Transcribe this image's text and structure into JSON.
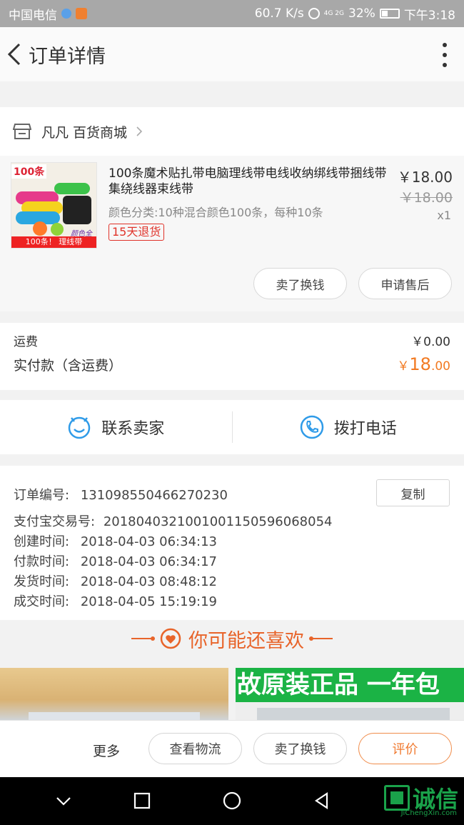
{
  "statusbar": {
    "carrier": "中国电信",
    "speed": "60.7 K/s",
    "network": "4G 2G",
    "battery": "32%",
    "time": "下午3:18"
  },
  "header": {
    "title": "订单详情"
  },
  "store": {
    "name": "凡凡 百货商城"
  },
  "product": {
    "name": "100条魔术贴扎带电脑理线带电线收纳绑线带捆线带集绕线器束线带",
    "spec": "颜色分类:10种混合颜色100条，每种10条",
    "badge": "15天退货",
    "price": "￥18.00",
    "original_price": "￥18.00",
    "quantity": "x1",
    "image_text_top": "100条",
    "image_text_bottom": "100条！ 理线带",
    "image_text_mid": "颜色全",
    "btn_sell": "卖了换钱",
    "btn_aftersale": "申请售后"
  },
  "fees": {
    "shipping_label": "运费",
    "shipping_value": "￥0.00",
    "total_label": "实付款（含运费）",
    "total_currency": "￥",
    "total_int": "18",
    "total_dec": ".00"
  },
  "contact": {
    "seller": "联系卖家",
    "phone": "拨打电话"
  },
  "order": {
    "number_label": "订单编号:",
    "number": "131098550466270230",
    "copy": "复制",
    "alipay_label": "支付宝交易号:",
    "alipay": "2018040321001001150596068054",
    "created_label": "创建时间:",
    "created": "2018-04-03 06:34:13",
    "paid_label": "付款时间:",
    "paid": "2018-04-03 06:34:17",
    "shipped_label": "发货时间:",
    "shipped": "2018-04-03 08:48:12",
    "done_label": "成交时间:",
    "done": "2018-04-05 15:19:19"
  },
  "recommend": {
    "title": "你可能还喜欢",
    "banner_text": "故原装正品 一年包"
  },
  "bottombar": {
    "more": "更多",
    "logistics": "查看物流",
    "sell": "卖了换钱",
    "review": "评价"
  },
  "watermark": {
    "text": "诚信",
    "sub": "JiChengXin.com"
  },
  "colors": {
    "accent": "#f27a22",
    "contact_blue": "#2f9be8"
  }
}
